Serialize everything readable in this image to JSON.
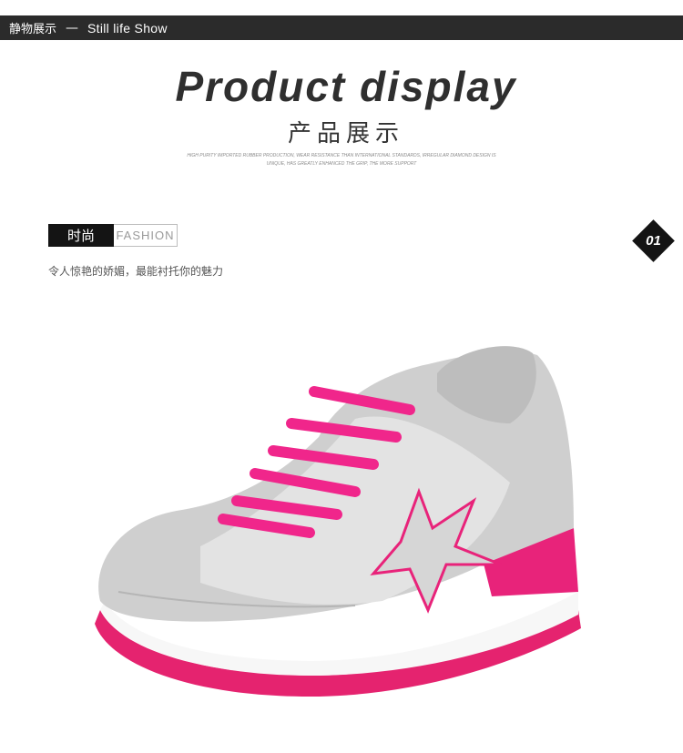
{
  "header": {
    "section_cn": "静物展示",
    "separator": "—",
    "section_en": "Still life Show"
  },
  "hero": {
    "title": "Product display",
    "subtitle": "产品展示",
    "fine_print": "HIGH PURITY IMPORTED RUBBER PRODUCTION, WEAR RESISTANCE THAN INTERNATIONAL STANDARDS, IRREGULAR DIAMOND DESIGN IS UNIQUE, HAS GREATLY ENHANCED THE GRIP, THE MORE SUPPORT"
  },
  "section": {
    "tag_cn": "时尚",
    "tag_en": "FASHION",
    "tagline": "令人惊艳的娇媚，最能衬托你的魅力",
    "number": "01"
  },
  "product": {
    "icon": "sneaker-image",
    "colors": {
      "upper": "#cfcfcf",
      "accent": "#e8237a",
      "sole": "#ffffff"
    }
  }
}
